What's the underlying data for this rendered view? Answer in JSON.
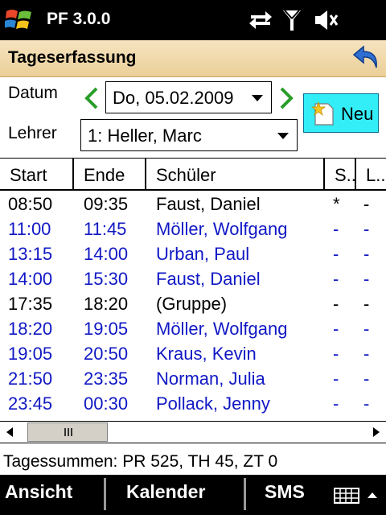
{
  "statusbar": {
    "app_title": "PF 3.0.0",
    "icons": [
      "windows-logo-icon",
      "sync-arrows-icon",
      "signal-antenna-icon",
      "speaker-muted-icon"
    ]
  },
  "titlebar": {
    "title": "Tageserfassung",
    "back_icon": "back-arrow-icon"
  },
  "form": {
    "date_label": "Datum",
    "date_value": "Do, 05.02.2009",
    "teacher_label": "Lehrer",
    "teacher_value": "1: Heller, Marc",
    "new_button_label": "Neu"
  },
  "table": {
    "columns": [
      "Start",
      "Ende",
      "Schüler",
      "S..",
      "L.."
    ],
    "rows": [
      {
        "start": "08:50",
        "end": "09:35",
        "student": "Faust, Daniel",
        "s": "*",
        "l": "-",
        "color": "#000000"
      },
      {
        "start": "11:00",
        "end": "11:45",
        "student": "Möller, Wolfgang",
        "s": "-",
        "l": "-",
        "color": "#1018c4"
      },
      {
        "start": "13:15",
        "end": "14:00",
        "student": "Urban, Paul",
        "s": "-",
        "l": "-",
        "color": "#1018c4"
      },
      {
        "start": "14:00",
        "end": "15:30",
        "student": "Faust, Daniel",
        "s": "-",
        "l": "-",
        "color": "#1018c4"
      },
      {
        "start": "17:35",
        "end": "18:20",
        "student": "(Gruppe)",
        "s": "-",
        "l": "-",
        "color": "#000000"
      },
      {
        "start": "18:20",
        "end": "19:05",
        "student": "Möller, Wolfgang",
        "s": "-",
        "l": "-",
        "color": "#1018c4"
      },
      {
        "start": "19:05",
        "end": "20:50",
        "student": "Kraus, Kevin",
        "s": "-",
        "l": "-",
        "color": "#1018c4"
      },
      {
        "start": "21:50",
        "end": "23:35",
        "student": "Norman, Julia",
        "s": "-",
        "l": "-",
        "color": "#1018c4"
      },
      {
        "start": "23:45",
        "end": "00:30",
        "student": "Pollack, Jenny",
        "s": "-",
        "l": "-",
        "color": "#1018c4"
      }
    ]
  },
  "summary": "Tagessummen: PR 525, TH 45, ZT 0",
  "softkeys": {
    "left": "Ansicht",
    "middle": "Kalender",
    "right": "SMS",
    "keyboard_icon": "keyboard-icon"
  },
  "colors": {
    "accent_title_bar": "#ebcf98",
    "new_button": "#33eef6",
    "row_blue": "#1018c4",
    "nav_arrow_green": "#2a9d2a"
  }
}
